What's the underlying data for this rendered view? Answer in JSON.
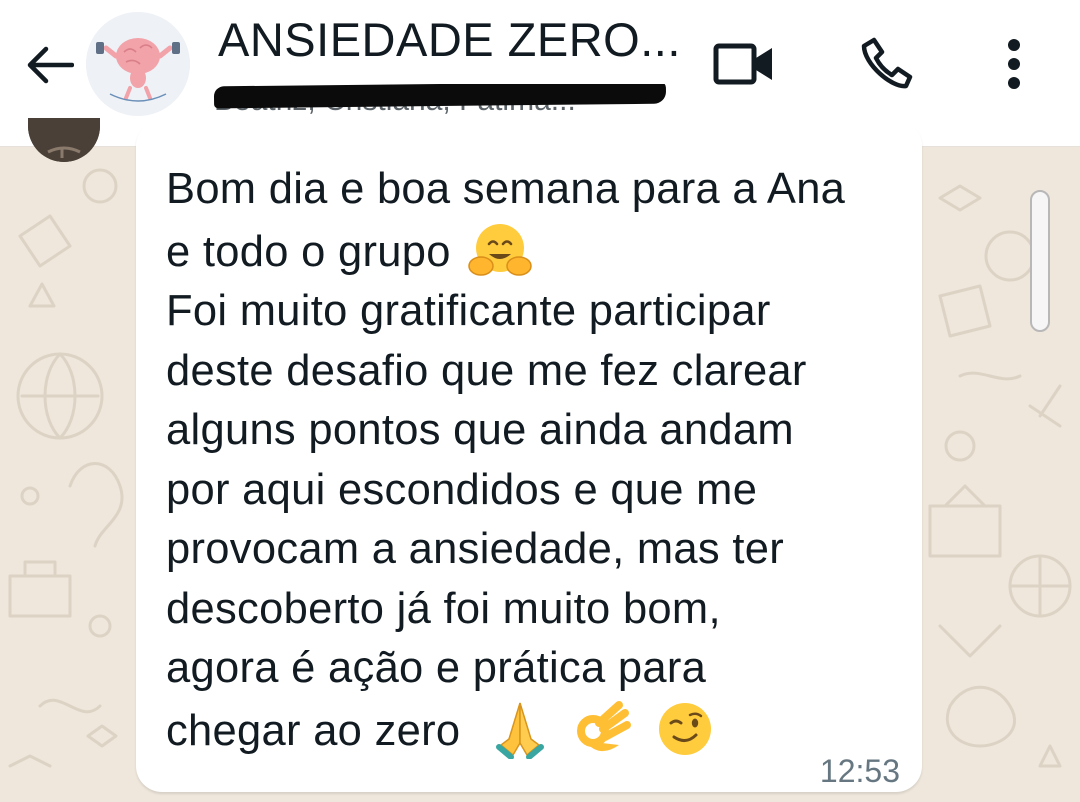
{
  "header": {
    "back_icon": "arrow-left-icon",
    "avatar_icon": "brain-mascot-icon",
    "title": "ANSIEDADE ZERO...",
    "members": "Beatriz, Cristiana, Fatima...",
    "video_icon": "video-camera-icon",
    "call_icon": "phone-icon",
    "more_icon": "more-vertical-icon"
  },
  "message": {
    "lines": [
      "Bom dia e boa semana para a Ana",
      "e todo o grupo",
      "Foi muito gratificante participar",
      "deste desafio que me fez clarear",
      "alguns pontos que ainda andam",
      "por aqui escondidos e que me",
      "provocam a ansiedade, mas ter",
      "descoberto já foi muito bom,",
      "agora é ação e prática para",
      "chegar ao zero"
    ],
    "emojis_line2": [
      "hugging-face-emoji"
    ],
    "emojis_last": [
      "folded-hands-emoji",
      "ok-hand-emoji",
      "winking-face-emoji"
    ],
    "time": "12:53"
  },
  "colors": {
    "header_bg": "#ffffff",
    "wallpaper": "#efe7dc",
    "bubble": "#ffffff",
    "text": "#111b21",
    "time": "#667781"
  }
}
